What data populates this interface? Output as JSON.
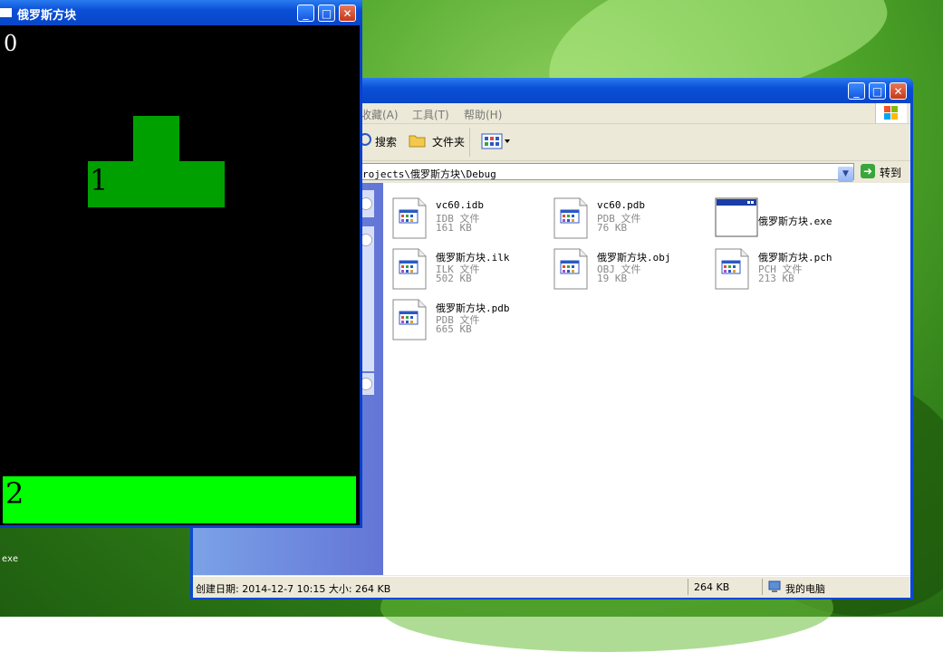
{
  "desktop": {
    "icon_label": "exe"
  },
  "explorer": {
    "menu": {
      "favorites": "收藏(A)",
      "tools": "工具(T)",
      "help": "帮助(H)"
    },
    "toolbar": {
      "search": "搜索",
      "folders": "文件夹"
    },
    "address": {
      "path": "rojects\\俄罗斯方块\\Debug",
      "go_label": "转到"
    },
    "files": [
      {
        "name": "vc60.idb",
        "type": "IDB 文件",
        "size": "161 KB",
        "icon": "generic-file-icon"
      },
      {
        "name": "vc60.pdb",
        "type": "PDB 文件",
        "size": "76 KB",
        "icon": "generic-file-icon"
      },
      {
        "name": "俄罗斯方块.exe",
        "type": "",
        "size": "",
        "icon": "application-window-icon"
      },
      {
        "name": "俄罗斯方块.ilk",
        "type": "ILK 文件",
        "size": "502 KB",
        "icon": "generic-file-icon"
      },
      {
        "name": "俄罗斯方块.obj",
        "type": "OBJ 文件",
        "size": "19 KB",
        "icon": "generic-file-icon"
      },
      {
        "name": "俄罗斯方块.pch",
        "type": "PCH 文件",
        "size": "213 KB",
        "icon": "generic-file-icon"
      },
      {
        "name": "俄罗斯方块.pdb",
        "type": "PDB 文件",
        "size": "665 KB",
        "icon": "generic-file-icon"
      }
    ],
    "status": {
      "info": "创建日期: 2014-12-7 10:15 大小: 264 KB",
      "size": "264 KB",
      "location": "我的电脑"
    }
  },
  "tetris": {
    "title": "俄罗斯方块",
    "score": "0",
    "piece_label": "1",
    "floor_label": "2",
    "block_color": "#00a000",
    "floor_color": "#00ff00"
  }
}
